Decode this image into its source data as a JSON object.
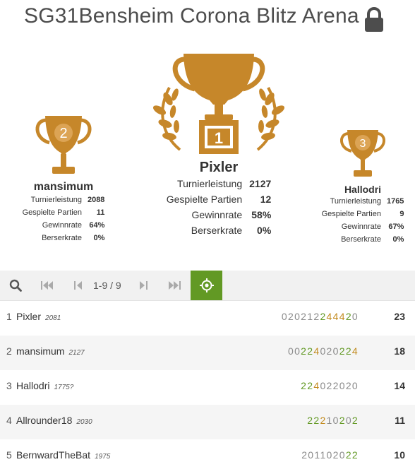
{
  "tournament": {
    "title": "SG31Bensheim Corona Blitz Arena"
  },
  "podium": {
    "first": {
      "place": "1",
      "name": "Pixler",
      "stats": [
        {
          "label": "Turnierleistung",
          "value": "2127"
        },
        {
          "label": "Gespielte Partien",
          "value": "12"
        },
        {
          "label": "Gewinnrate",
          "value": "58%"
        },
        {
          "label": "Berserkrate",
          "value": "0%"
        }
      ]
    },
    "second": {
      "place": "2",
      "name": "mansimum",
      "stats": [
        {
          "label": "Turnierleistung",
          "value": "2088"
        },
        {
          "label": "Gespielte Partien",
          "value": "11"
        },
        {
          "label": "Gewinnrate",
          "value": "64%"
        },
        {
          "label": "Berserkrate",
          "value": "0%"
        }
      ]
    },
    "third": {
      "place": "3",
      "name": "Hallodri",
      "stats": [
        {
          "label": "Turnierleistung",
          "value": "1765"
        },
        {
          "label": "Gespielte Partien",
          "value": "9"
        },
        {
          "label": "Gewinnrate",
          "value": "67%"
        },
        {
          "label": "Berserkrate",
          "value": "0%"
        }
      ]
    }
  },
  "pager": {
    "range": "1-9 / 9"
  },
  "standings": [
    {
      "rank": "1",
      "name": "Pixler",
      "rating": "2081",
      "sheet": "02021224442 0",
      "score": "23",
      "digits": [
        "0",
        "2",
        "0",
        "2",
        "1",
        "2",
        "2",
        "4",
        "4",
        "4",
        "2",
        "0"
      ],
      "tones": [
        "lo",
        "lo",
        "lo",
        "lo",
        "lo",
        "lo",
        "mid",
        "hi",
        "hi",
        "hi",
        "mid",
        "lo"
      ]
    },
    {
      "rank": "2",
      "name": "mansimum",
      "rating": "2127",
      "sheet": "00224020224",
      "score": "18",
      "digits": [
        "0",
        "0",
        "2",
        "2",
        "4",
        "0",
        "2",
        "0",
        "2",
        "2",
        "4"
      ],
      "tones": [
        "lo",
        "lo",
        "mid",
        "mid",
        "hi",
        "lo",
        "lo",
        "lo",
        "mid",
        "mid",
        "hi"
      ]
    },
    {
      "rank": "3",
      "name": "Hallodri",
      "rating": "1775?",
      "sheet": "224022020",
      "score": "14",
      "digits": [
        "2",
        "2",
        "4",
        "0",
        "2",
        "2",
        "0",
        "2",
        "0"
      ],
      "tones": [
        "mid",
        "mid",
        "hi",
        "lo",
        "lo",
        "lo",
        "lo",
        "lo",
        "lo"
      ]
    },
    {
      "rank": "4",
      "name": "Allrounder18",
      "rating": "2030",
      "sheet": "22210202",
      "score": "11",
      "digits": [
        "2",
        "2",
        "2",
        "1",
        "0",
        "2",
        "0",
        "2"
      ],
      "tones": [
        "mid",
        "mid",
        "hi",
        "lo",
        "lo",
        "mid",
        "lo",
        "mid"
      ]
    },
    {
      "rank": "5",
      "name": "BernwardTheBat",
      "rating": "1975",
      "sheet": "201102022",
      "score": "10",
      "digits": [
        "2",
        "0",
        "1",
        "1",
        "0",
        "2",
        "0",
        "2",
        "2"
      ],
      "tones": [
        "lo",
        "lo",
        "lo",
        "lo",
        "lo",
        "lo",
        "lo",
        "mid",
        "mid"
      ]
    }
  ],
  "colors": {
    "accent": "#629924",
    "gold": "#c28a1d",
    "trophy": "#c6872a"
  },
  "icons": [
    "lock-icon",
    "trophy-icon",
    "laurel-icon",
    "search-icon",
    "first-page-icon",
    "prev-page-icon",
    "next-page-icon",
    "last-page-icon",
    "target-icon"
  ]
}
